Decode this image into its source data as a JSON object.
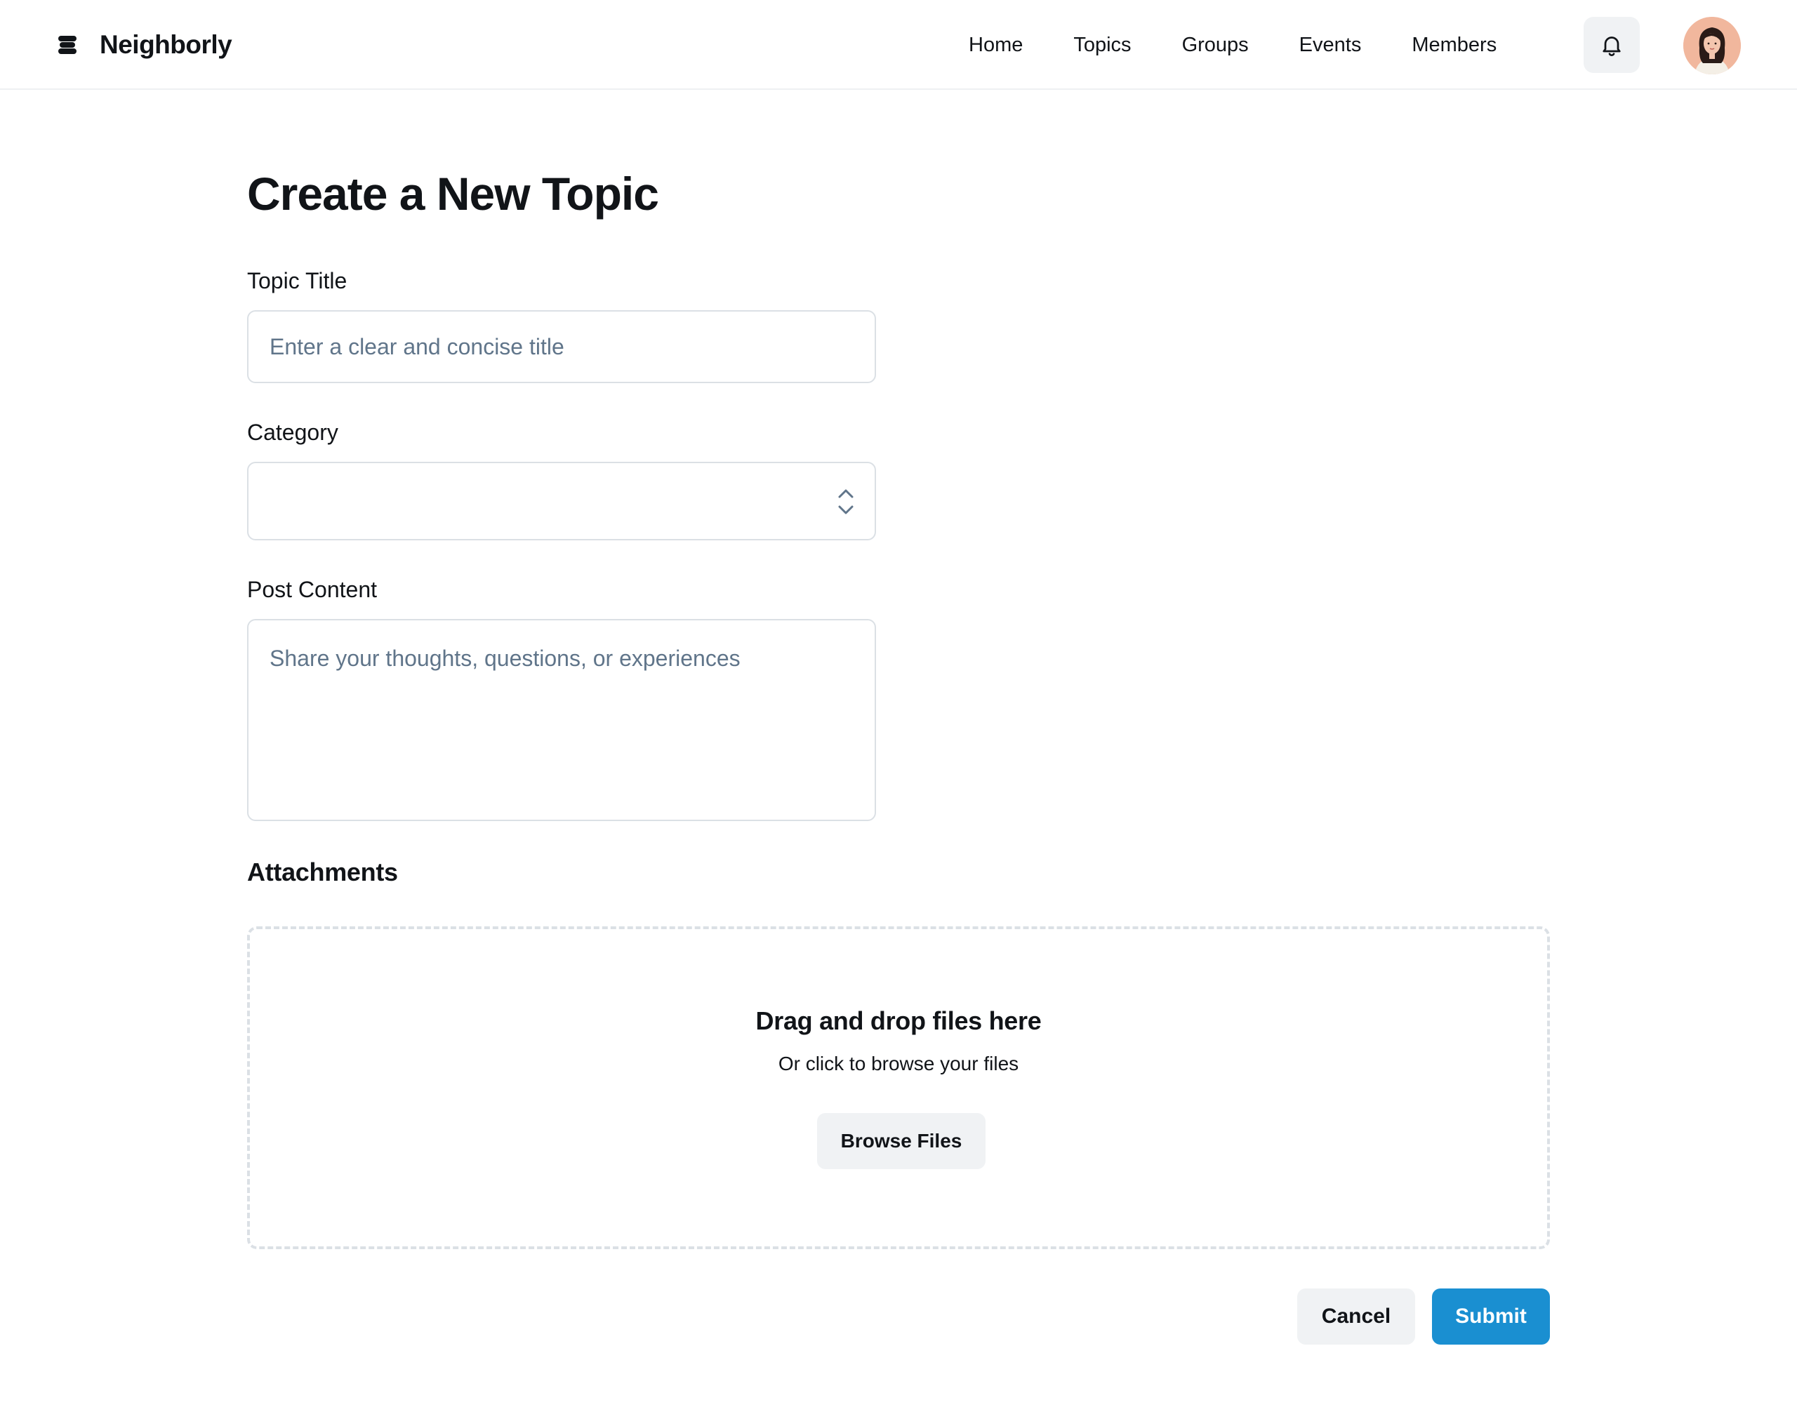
{
  "header": {
    "brand_name": "Neighborly",
    "brand_icon": "stacked-layers-logo-icon",
    "nav": [
      {
        "label": "Home"
      },
      {
        "label": "Topics"
      },
      {
        "label": "Groups"
      },
      {
        "label": "Events"
      },
      {
        "label": "Members"
      }
    ],
    "notifications_icon": "bell-icon",
    "avatar_icon": "user-avatar"
  },
  "form": {
    "page_title": "Create a New Topic",
    "topic_title": {
      "label": "Topic Title",
      "value": "",
      "placeholder": "Enter a clear and concise title"
    },
    "category": {
      "label": "Category",
      "value": ""
    },
    "post_content": {
      "label": "Post Content",
      "value": "",
      "placeholder": "Share your thoughts, questions, or experiences"
    },
    "attachments": {
      "title": "Attachments",
      "dropzone_title": "Drag and drop files here",
      "dropzone_subtitle": "Or click to browse your files",
      "browse_label": "Browse Files"
    },
    "actions": {
      "cancel_label": "Cancel",
      "submit_label": "Submit"
    }
  },
  "colors": {
    "primary": "#1a8fd1",
    "secondary_button_bg": "#f0f2f4",
    "border": "#dbe0e5",
    "placeholder": "#60758a",
    "text": "#111418"
  }
}
